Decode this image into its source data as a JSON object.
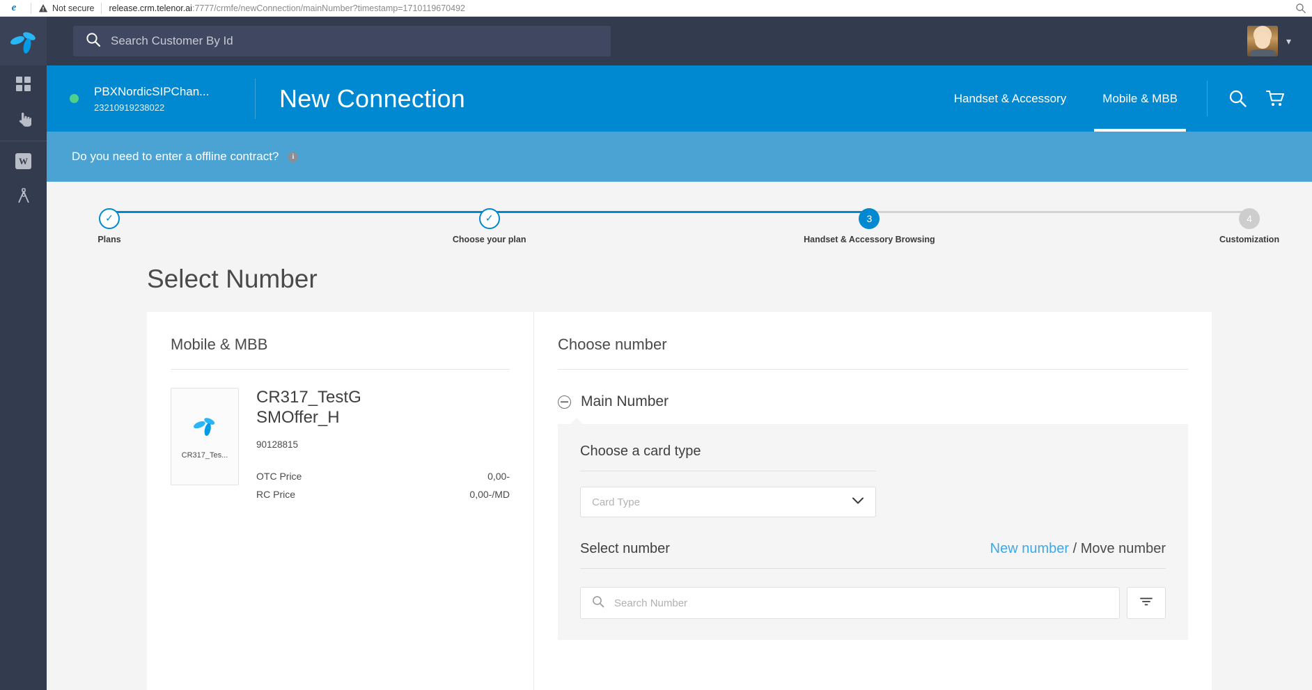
{
  "browser": {
    "security_label": "Not secure",
    "url_host": "release.crm.telenor.ai",
    "url_rest": ":7777/crmfe/newConnection/mainNumber?timestamp=1710119670492"
  },
  "rail": {
    "items": [
      {
        "name": "telenor-logo",
        "label": "Telenor"
      },
      {
        "name": "dashboard",
        "label": "Dashboard"
      },
      {
        "name": "pointer",
        "label": "Actions"
      },
      {
        "name": "w-app",
        "label": "W"
      },
      {
        "name": "compass",
        "label": "Design"
      }
    ]
  },
  "topbar": {
    "search_placeholder": "Search Customer By Id",
    "search_value": ""
  },
  "context_header": {
    "customer_name": "PBXNordicSIPChan...",
    "customer_id": "23210919238022",
    "title": "New Connection",
    "tabs": [
      {
        "label": "Handset & Accessory",
        "active": false
      },
      {
        "label": "Mobile & MBB",
        "active": true
      }
    ]
  },
  "offline_banner": {
    "text": "Do you need to enter a offline contract?",
    "info_glyph": "i"
  },
  "stepper": {
    "steps": [
      {
        "label": "Plans",
        "state": "done",
        "marker": "✓"
      },
      {
        "label": "Choose your plan",
        "state": "done",
        "marker": "✓"
      },
      {
        "label": "Handset & Accessory Browsing",
        "state": "current",
        "marker": "3"
      },
      {
        "label": "Customization",
        "state": "todo",
        "marker": "4"
      }
    ]
  },
  "page": {
    "title": "Select Number"
  },
  "left_panel": {
    "heading": "Mobile & MBB",
    "product": {
      "thumb_caption": "CR317_Tes...",
      "name": "CR317_TestG SMOffer_H",
      "number": "90128815",
      "prices": [
        {
          "label": "OTC Price",
          "value": "0,00-"
        },
        {
          "label": "RC Price",
          "value": "0,00-/MD"
        }
      ]
    }
  },
  "right_panel": {
    "heading": "Choose number",
    "accordion_title": "Main Number",
    "card_type_label": "Choose a card type",
    "card_type_placeholder": "Card Type",
    "card_type_value": "",
    "select_number_label": "Select number",
    "mode_new": "New number",
    "mode_separator": " / ",
    "mode_move": "Move number",
    "search_placeholder": "Search Number",
    "search_value": ""
  },
  "colors": {
    "brand_blue": "#0089d0",
    "rail_dark": "#333b4f",
    "banner_blue": "#4ba3d3",
    "link_blue": "#3ba9e8",
    "status_green": "#4fd18b"
  }
}
